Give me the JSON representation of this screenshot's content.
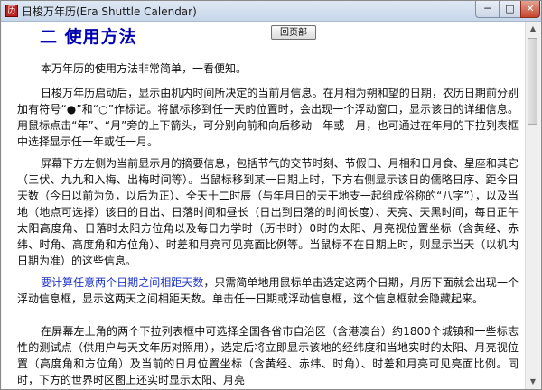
{
  "window": {
    "title": "日梭万年历(Era Shuttle Calendar)",
    "icon_glyph": "历",
    "minimize": "─",
    "maximize": "□",
    "close": "✕"
  },
  "page": {
    "section_title": "二  使用方法",
    "back_button": "回页部",
    "p1": "本万年历的使用方法非常简单，一看便知。",
    "p2": "日梭万年历启动后，显示由机内时间所决定的当前月信息。在月相为朔和望的日期，农历日期前分别加有符号“●”和“○”作标记。将鼠标移到任一天的位置时，会出现一个浮动窗口，显示该日的详细信息。用鼠标点击“年”、“月”旁的上下箭头，可分别向前和向后移动一年或一月，也可通过在年月的下拉列表框中选择显示任一年或任一月。",
    "p3": "屏幕下方左侧为当前显示月的摘要信息，包括节气的交节时刻、节假日、月相和日月食、星座和其它（三伏、九九和入梅、出梅时间等）。当鼠标移到某一日期上时，下方右侧显示该日的儒略日序、距今日天数（今日以前为负，以后为正）、全天十二时辰（与年月日的天干地支一起组成俗称的“八字”），以及当地（地点可选择）该日的日出、日落时间和昼长（日出到日落的时间长度）、天亮、天黑时间，每日正午太阳高度角、日落时太阳方位角以及每日力学时（历书时）0时的太阳、月亮视位置坐标（含黄经、赤纬、时角、高度角和方位角）、时差和月亮可见亮面比例等。当鼠标不在日期上时，则显示当天（以机内日期为准）的这些信息。",
    "p4_highlight": "要计算任意两个日期之间相距天数",
    "p4_rest": "，只需简单地用鼠标单击选定这两个日期，月历下面就会出现一个浮动信息框，显示这两天之间相距天数。单击任一日期或浮动信息框，这个信息框就会隐藏起来。",
    "p5": "在屏幕左上角的两个下拉列表框中可选择全国各省市自治区（含港澳台）约1800个城镇和一些标志性的测试点（供用户与天文年历对照用），选定后将立即显示该地的经纬度和当地实时的太阳、月亮视位置（高度角和方位角）及当前的日月位置坐标（含黄经、赤纬、时角）、时差和月亮可见亮面比例。同时，下方的世界时区图上还实时显示太阳、月亮"
  },
  "scrollbar": {
    "up": "▲",
    "down": "▼",
    "thumb_fraction": 0.26
  },
  "colors": {
    "title_blue": "#0000b0",
    "link_blue": "#1f35c8"
  }
}
